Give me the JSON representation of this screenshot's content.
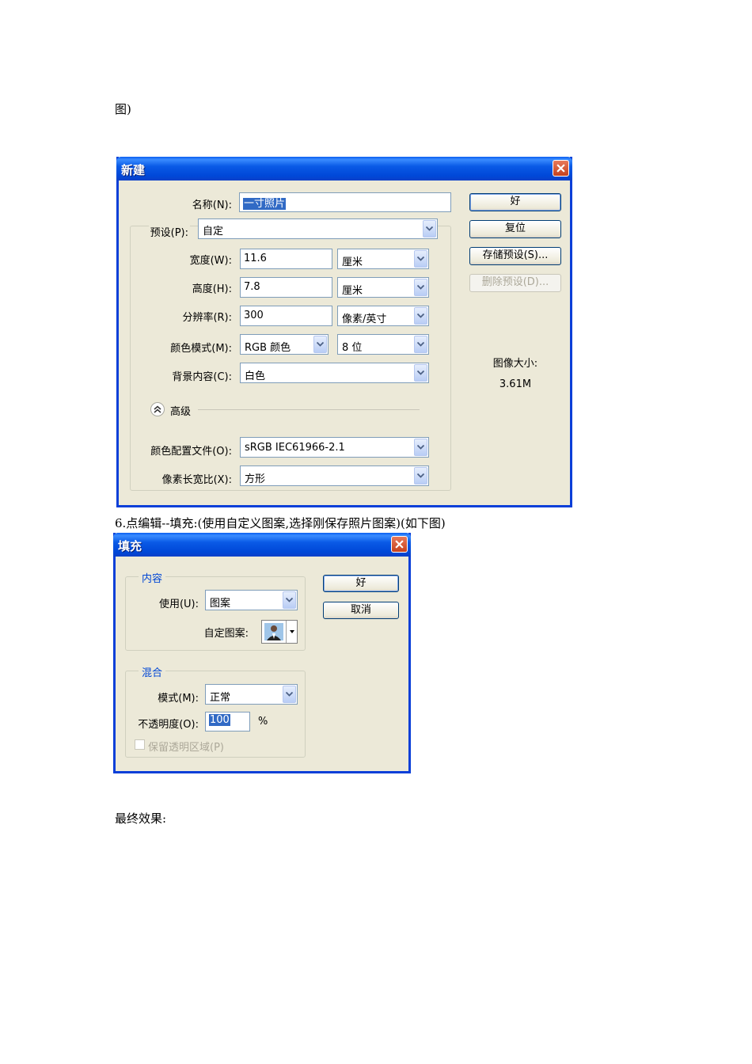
{
  "doc": {
    "top_line": "图)",
    "step6": "6.点编辑--填充:(使用自定义图案,选择刚保存照片图案)(如下图)",
    "final": "最终效果:"
  },
  "new_dialog": {
    "title": "新建",
    "name_label": "名称(N):",
    "name_value": "一寸照片",
    "preset_label": "预设(P):",
    "preset_value": "自定",
    "width_label": "宽度(W):",
    "width_value": "11.6",
    "width_unit": "厘米",
    "height_label": "高度(H):",
    "height_value": "7.8",
    "height_unit": "厘米",
    "resolution_label": "分辨率(R):",
    "resolution_value": "300",
    "resolution_unit": "像素/英寸",
    "color_mode_label": "颜色模式(M):",
    "color_mode_value": "RGB 颜色",
    "bit_depth": "8 位",
    "background_label": "背景内容(C):",
    "background_value": "白色",
    "advanced_label": "高级",
    "profile_label": "颜色配置文件(O):",
    "profile_value": "sRGB IEC61966-2.1",
    "aspect_label": "像素长宽比(X):",
    "aspect_value": "方形",
    "ok": "好",
    "reset": "复位",
    "save_preset": "存储预设(S)...",
    "delete_preset": "删除预设(D)...",
    "image_size_label": "图像大小:",
    "image_size_value": "3.61M"
  },
  "fill_dialog": {
    "title": "填充",
    "content_group": "内容",
    "use_label": "使用(U):",
    "use_value": "图案",
    "custom_pattern_label": "自定图案:",
    "blend_group": "混合",
    "mode_label": "模式(M):",
    "mode_value": "正常",
    "opacity_label": "不透明度(O):",
    "opacity_value": "100",
    "opacity_unit": "%",
    "preserve_label": "保留透明区域(P)",
    "ok": "好",
    "cancel": "取消"
  },
  "colors": {
    "title_bar": "#0a5ae6",
    "dialog_bg": "#ece9d8",
    "group_title": "#0046d5",
    "close": "#c6421e"
  }
}
